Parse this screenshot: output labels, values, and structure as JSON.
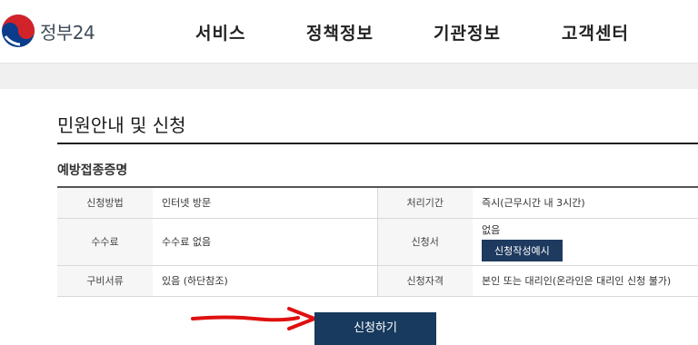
{
  "header": {
    "logo_text": "정부24",
    "nav": [
      "서비스",
      "정책정보",
      "기관정보",
      "고객센터"
    ]
  },
  "page": {
    "title": "민원안내 및 신청",
    "section_title": "예방접종증명"
  },
  "table": {
    "rows": [
      {
        "label1": "신청방법",
        "value1": "인터넷 방문",
        "label2": "처리기간",
        "value2": "즉시(근무시간 내 3시간)"
      },
      {
        "label1": "수수료",
        "value1": "수수료 없음",
        "label2": "신청서",
        "value2": "없음",
        "button": "신청작성예시"
      },
      {
        "label1": "구비서류",
        "value1": "있음 (하단참조)",
        "label2": "신청자격",
        "value2": "본인 또는 대리인(온라인은 대리인 신청 불가)"
      }
    ]
  },
  "actions": {
    "apply_label": "신청하기"
  },
  "colors": {
    "primary": "#173a5e",
    "arrow": "#e01010",
    "logo_red": "#d2232a",
    "logo_blue": "#0b3c8c"
  },
  "icons": {
    "logo": "taegeuk-logo-icon",
    "annotation": "red-arrow-icon"
  }
}
